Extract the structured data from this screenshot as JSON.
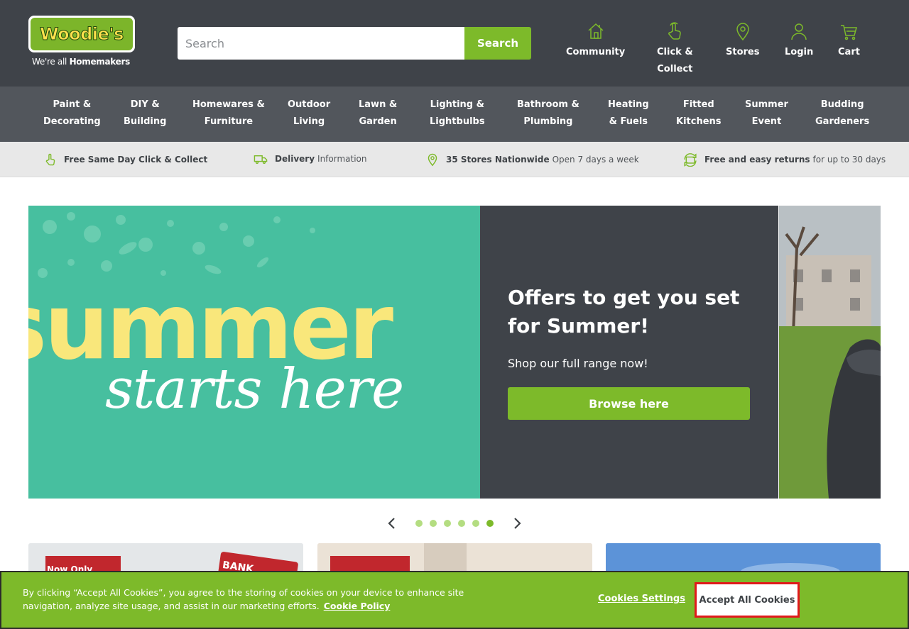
{
  "header": {
    "logo": {
      "word": "Woodie's",
      "tagline_light": "We're all ",
      "tagline_bold": "Homemakers"
    },
    "search": {
      "placeholder": "Search",
      "button_label": "Search"
    },
    "links": [
      {
        "label": "Community",
        "icon": "house-icon"
      },
      {
        "label": "Click &\nCollect",
        "icon": "hand-pointer-icon"
      },
      {
        "label": "Stores",
        "icon": "map-pin-icon"
      },
      {
        "label": "Login",
        "icon": "user-icon"
      },
      {
        "label": "Cart",
        "icon": "cart-icon"
      }
    ]
  },
  "categories": [
    "Paint &\nDecorating",
    "DIY &\nBuilding",
    "Homewares &\nFurniture",
    "Outdoor\nLiving",
    "Lawn &\nGarden",
    "Lighting &\nLightbulbs",
    "Bathroom &\nPlumbing",
    "Heating\n& Fuels",
    "Fitted\nKitchens",
    "Summer\nEvent",
    "Budding\nGardeners"
  ],
  "usp": [
    {
      "bold": "Free Same Day Click & Collect",
      "text": "",
      "icon": "hand-pointer-icon"
    },
    {
      "bold": "Delivery",
      "text": "Information",
      "icon": "truck-icon"
    },
    {
      "bold": "35 Stores Nationwide",
      "text": "Open 7 days a week",
      "icon": "map-pin-icon"
    },
    {
      "bold": "Free and easy returns",
      "text": "for up to 30 days",
      "icon": "returns-icon"
    }
  ],
  "hero": {
    "art_line1": "summer",
    "art_line2": "starts here",
    "title": "Offers to get you set for Summer!",
    "subtitle": "Shop our full range now!",
    "button_label": "Browse here"
  },
  "carousel": {
    "slide_count": 6,
    "active_index": 5
  },
  "promo_cards": [
    {
      "tag": "Now Only",
      "badge": "BANK"
    },
    {
      "tag": ""
    },
    {
      "tag": ""
    }
  ],
  "cookie": {
    "text": "By clicking “Accept All Cookies”, you agree to the storing of cookies on your device to enhance site navigation, analyze site usage, and assist in our marketing efforts.",
    "policy_link": "Cookie Policy",
    "settings_label": "Cookies Settings",
    "accept_label": "Accept All Cookies"
  },
  "colors": {
    "header_bg": "#3f4349",
    "nav_bg": "#52565c",
    "brand_green": "#7dba2a",
    "hero_teal": "#47bf9f",
    "hero_yellow": "#f9e77b",
    "accept_border": "#e0191b"
  }
}
